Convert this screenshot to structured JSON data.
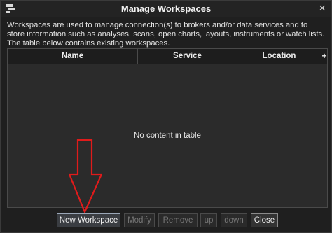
{
  "window": {
    "title": "Manage Workspaces",
    "close_glyph": "×",
    "icon": "app-logo-icon"
  },
  "description": "Workspaces are used to manage connection(s) to brokers and/or data services and to store information such as analyses, scans, open charts, layouts, instruments or watch lists. The table below contains existing workspaces.",
  "table": {
    "columns": [
      "Name",
      "Service",
      "Location"
    ],
    "add_column_glyph": "+",
    "empty_text": "No content in table"
  },
  "buttons": {
    "new_workspace": "New Workspace",
    "modify": "Modify",
    "remove": "Remove",
    "up": "up",
    "down": "down",
    "close": "Close"
  },
  "annotation": {
    "icon": "red-down-arrow-icon",
    "color": "#e01b1b"
  }
}
